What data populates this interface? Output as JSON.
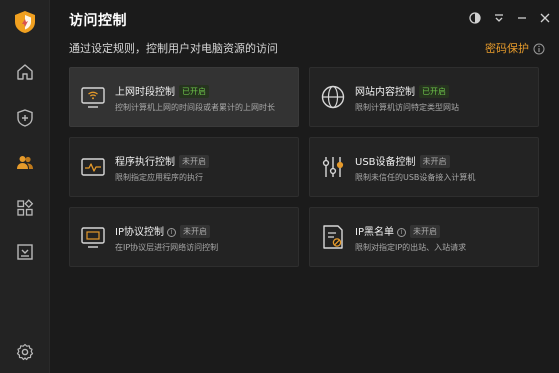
{
  "app": {
    "title": "访问控制",
    "subtitle": "通过设定规则，控制用户对电脑资源的访问",
    "password_protect": "密码保护",
    "accent_color": "#e59a2b"
  },
  "sidebar": {
    "items": [
      {
        "icon": "home-icon"
      },
      {
        "icon": "shield-plus-icon"
      },
      {
        "icon": "users-icon",
        "active": true
      },
      {
        "icon": "apps-icon"
      },
      {
        "icon": "inbox-icon"
      }
    ],
    "settings_icon": "gear-icon"
  },
  "window_controls": [
    "theme-icon",
    "menu-icon",
    "minimize-icon",
    "close-icon"
  ],
  "cards": [
    {
      "name": "上网时段控制",
      "status": "已开启",
      "status_on": true,
      "desc": "控制计算机上网的时间段或者累计的上网时长",
      "icon": "monitor-wifi-icon"
    },
    {
      "name": "网站内容控制",
      "status": "已开启",
      "status_on": true,
      "desc": "限制计算机访问特定类型网站",
      "icon": "globe-icon"
    },
    {
      "name": "程序执行控制",
      "status": "未开启",
      "status_on": false,
      "desc": "限制指定应用程序的执行",
      "icon": "program-window-icon"
    },
    {
      "name": "USB设备控制",
      "status": "未开启",
      "status_on": false,
      "desc": "限制未信任的USB设备接入计算机",
      "icon": "sliders-icon"
    },
    {
      "name": "IP协议控制",
      "status": "未开启",
      "status_on": false,
      "desc": "在IP协议层进行网络访问控制",
      "icon": "monitor-icon"
    },
    {
      "name": "IP黑名单",
      "status": "未开启",
      "status_on": false,
      "desc": "限制对指定IP的出站、入站请求",
      "icon": "blocklist-icon"
    }
  ]
}
